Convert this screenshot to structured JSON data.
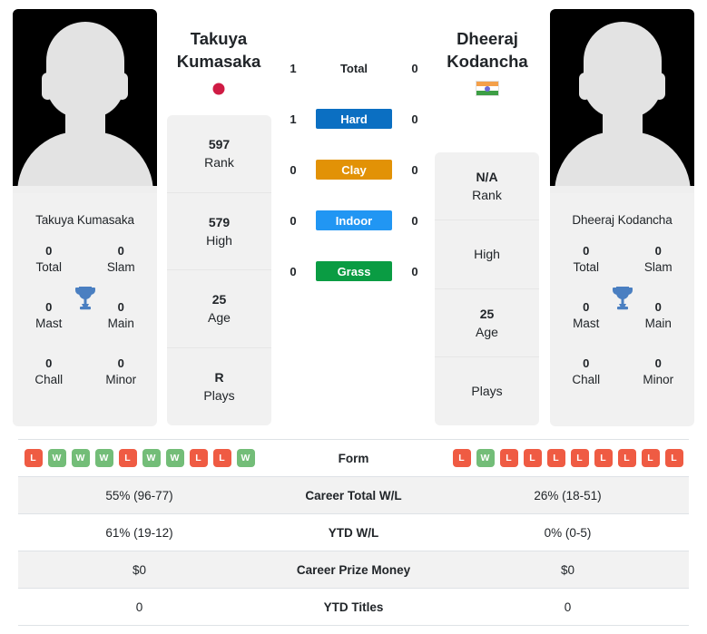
{
  "players": {
    "left": {
      "first_name": "Takuya",
      "last_name": "Kumasaka",
      "full_name": "Takuya Kumasaka",
      "flag": "jp-flag",
      "titles": [
        {
          "value": "0",
          "label": "Total"
        },
        {
          "value": "0",
          "label": "Slam"
        },
        {
          "value": "0",
          "label": "Mast"
        },
        {
          "value": "0",
          "label": "Main"
        },
        {
          "value": "0",
          "label": "Chall"
        },
        {
          "value": "0",
          "label": "Minor"
        }
      ],
      "stats": [
        {
          "value": "597",
          "label": "Rank"
        },
        {
          "value": "579",
          "label": "High"
        },
        {
          "value": "25",
          "label": "Age"
        },
        {
          "value": "R",
          "label": "Plays"
        }
      ],
      "form": [
        "L",
        "W",
        "W",
        "W",
        "L",
        "W",
        "W",
        "L",
        "L",
        "W"
      ]
    },
    "right": {
      "first_name": "Dheeraj",
      "last_name": "Kodancha",
      "full_name": "Dheeraj Kodancha",
      "flag": "in-flag",
      "titles": [
        {
          "value": "0",
          "label": "Total"
        },
        {
          "value": "0",
          "label": "Slam"
        },
        {
          "value": "0",
          "label": "Mast"
        },
        {
          "value": "0",
          "label": "Main"
        },
        {
          "value": "0",
          "label": "Chall"
        },
        {
          "value": "0",
          "label": "Minor"
        }
      ],
      "stats": [
        {
          "value": "N/A",
          "label": "Rank"
        },
        {
          "value": "",
          "label": "High"
        },
        {
          "value": "25",
          "label": "Age"
        },
        {
          "value": "",
          "label": "Plays"
        }
      ],
      "form": [
        "L",
        "W",
        "L",
        "L",
        "L",
        "L",
        "L",
        "L",
        "L",
        "L"
      ]
    }
  },
  "surfaces": [
    {
      "label": "Total",
      "left": "1",
      "right": "0",
      "color": "transparent",
      "plain": true
    },
    {
      "label": "Hard",
      "left": "1",
      "right": "0",
      "color": "#0b6fc2"
    },
    {
      "label": "Clay",
      "left": "0",
      "right": "0",
      "color": "#e29206"
    },
    {
      "label": "Indoor",
      "left": "0",
      "right": "0",
      "color": "#2196f3"
    },
    {
      "label": "Grass",
      "left": "0",
      "right": "0",
      "color": "#0a9c43"
    }
  ],
  "table": {
    "form_label": "Form",
    "rows": [
      {
        "label": "Career Total W/L",
        "left": "55% (96-77)",
        "right": "26% (18-51)"
      },
      {
        "label": "YTD W/L",
        "left": "61% (19-12)",
        "right": "0% (0-5)"
      },
      {
        "label": "Career Prize Money",
        "left": "$0",
        "right": "$0"
      },
      {
        "label": "YTD Titles",
        "left": "0",
        "right": "0"
      }
    ]
  },
  "colors": {
    "win": "#73bd78",
    "loss": "#ef5b43",
    "trophy": "#4a7fc1",
    "card_bg": "#f1f1f1",
    "row_stripe": "#f2f2f2"
  }
}
